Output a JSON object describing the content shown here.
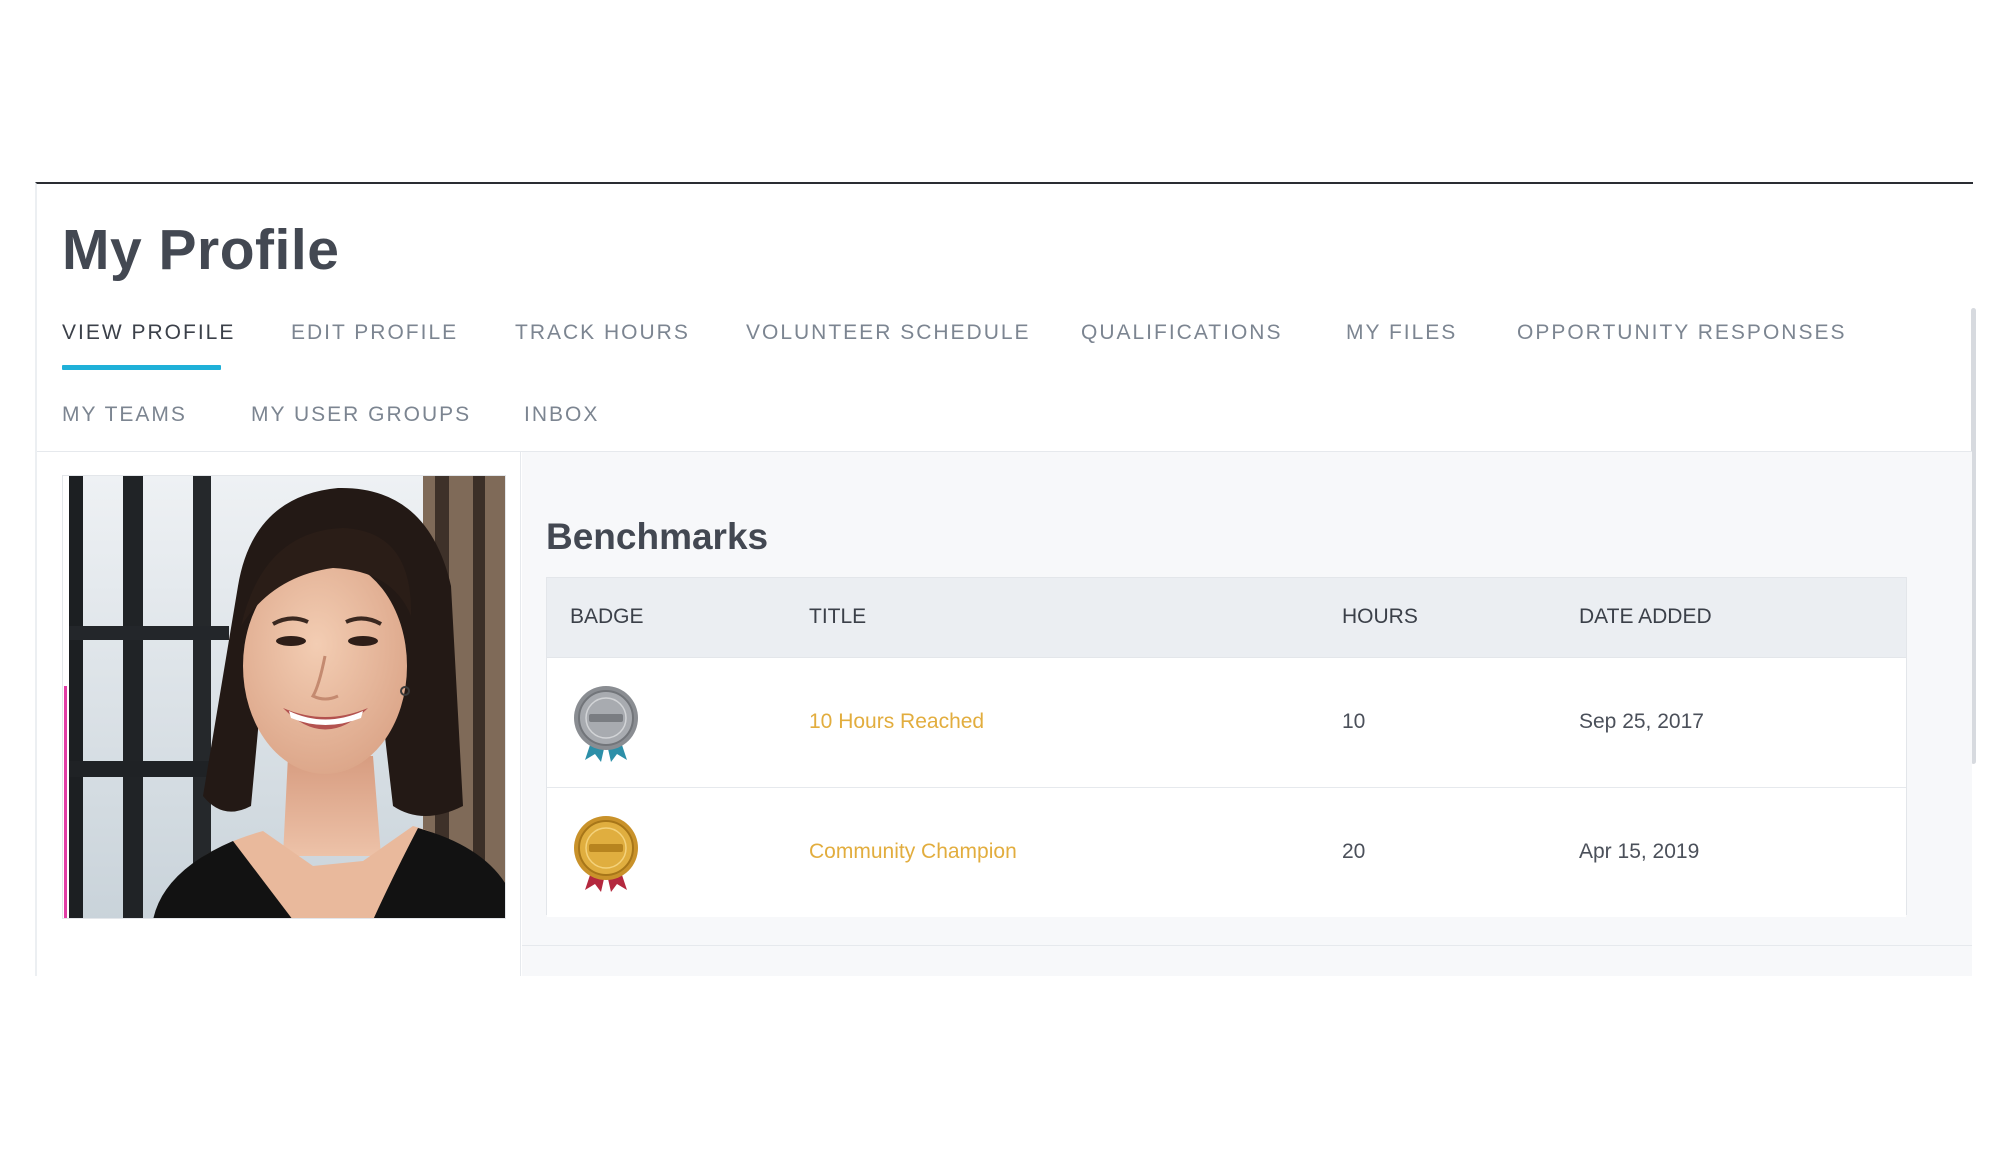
{
  "page": {
    "title": "My Profile"
  },
  "tabs": [
    {
      "label": "VIEW PROFILE",
      "active": true
    },
    {
      "label": "EDIT PROFILE"
    },
    {
      "label": "TRACK HOURS"
    },
    {
      "label": "VOLUNTEER SCHEDULE"
    },
    {
      "label": "QUALIFICATIONS"
    },
    {
      "label": "MY FILES"
    },
    {
      "label": "OPPORTUNITY RESPONSES"
    },
    {
      "label": "MY TEAMS"
    },
    {
      "label": "MY USER GROUPS"
    },
    {
      "label": "INBOX"
    }
  ],
  "benchmarks": {
    "title": "Benchmarks",
    "columns": [
      "BADGE",
      "TITLE",
      "HOURS",
      "DATE ADDED"
    ],
    "rows": [
      {
        "badge_icon": "silver-medal-icon",
        "title": "10 Hours Reached",
        "hours": "10",
        "date_added": "Sep 25, 2017"
      },
      {
        "badge_icon": "gold-medal-icon",
        "title": "Community Champion",
        "hours": "20",
        "date_added": "Apr 15, 2019"
      }
    ]
  },
  "colors": {
    "active_tab_underline": "#1fb0d8",
    "link": "#e2ad3e",
    "heading": "#434852"
  }
}
